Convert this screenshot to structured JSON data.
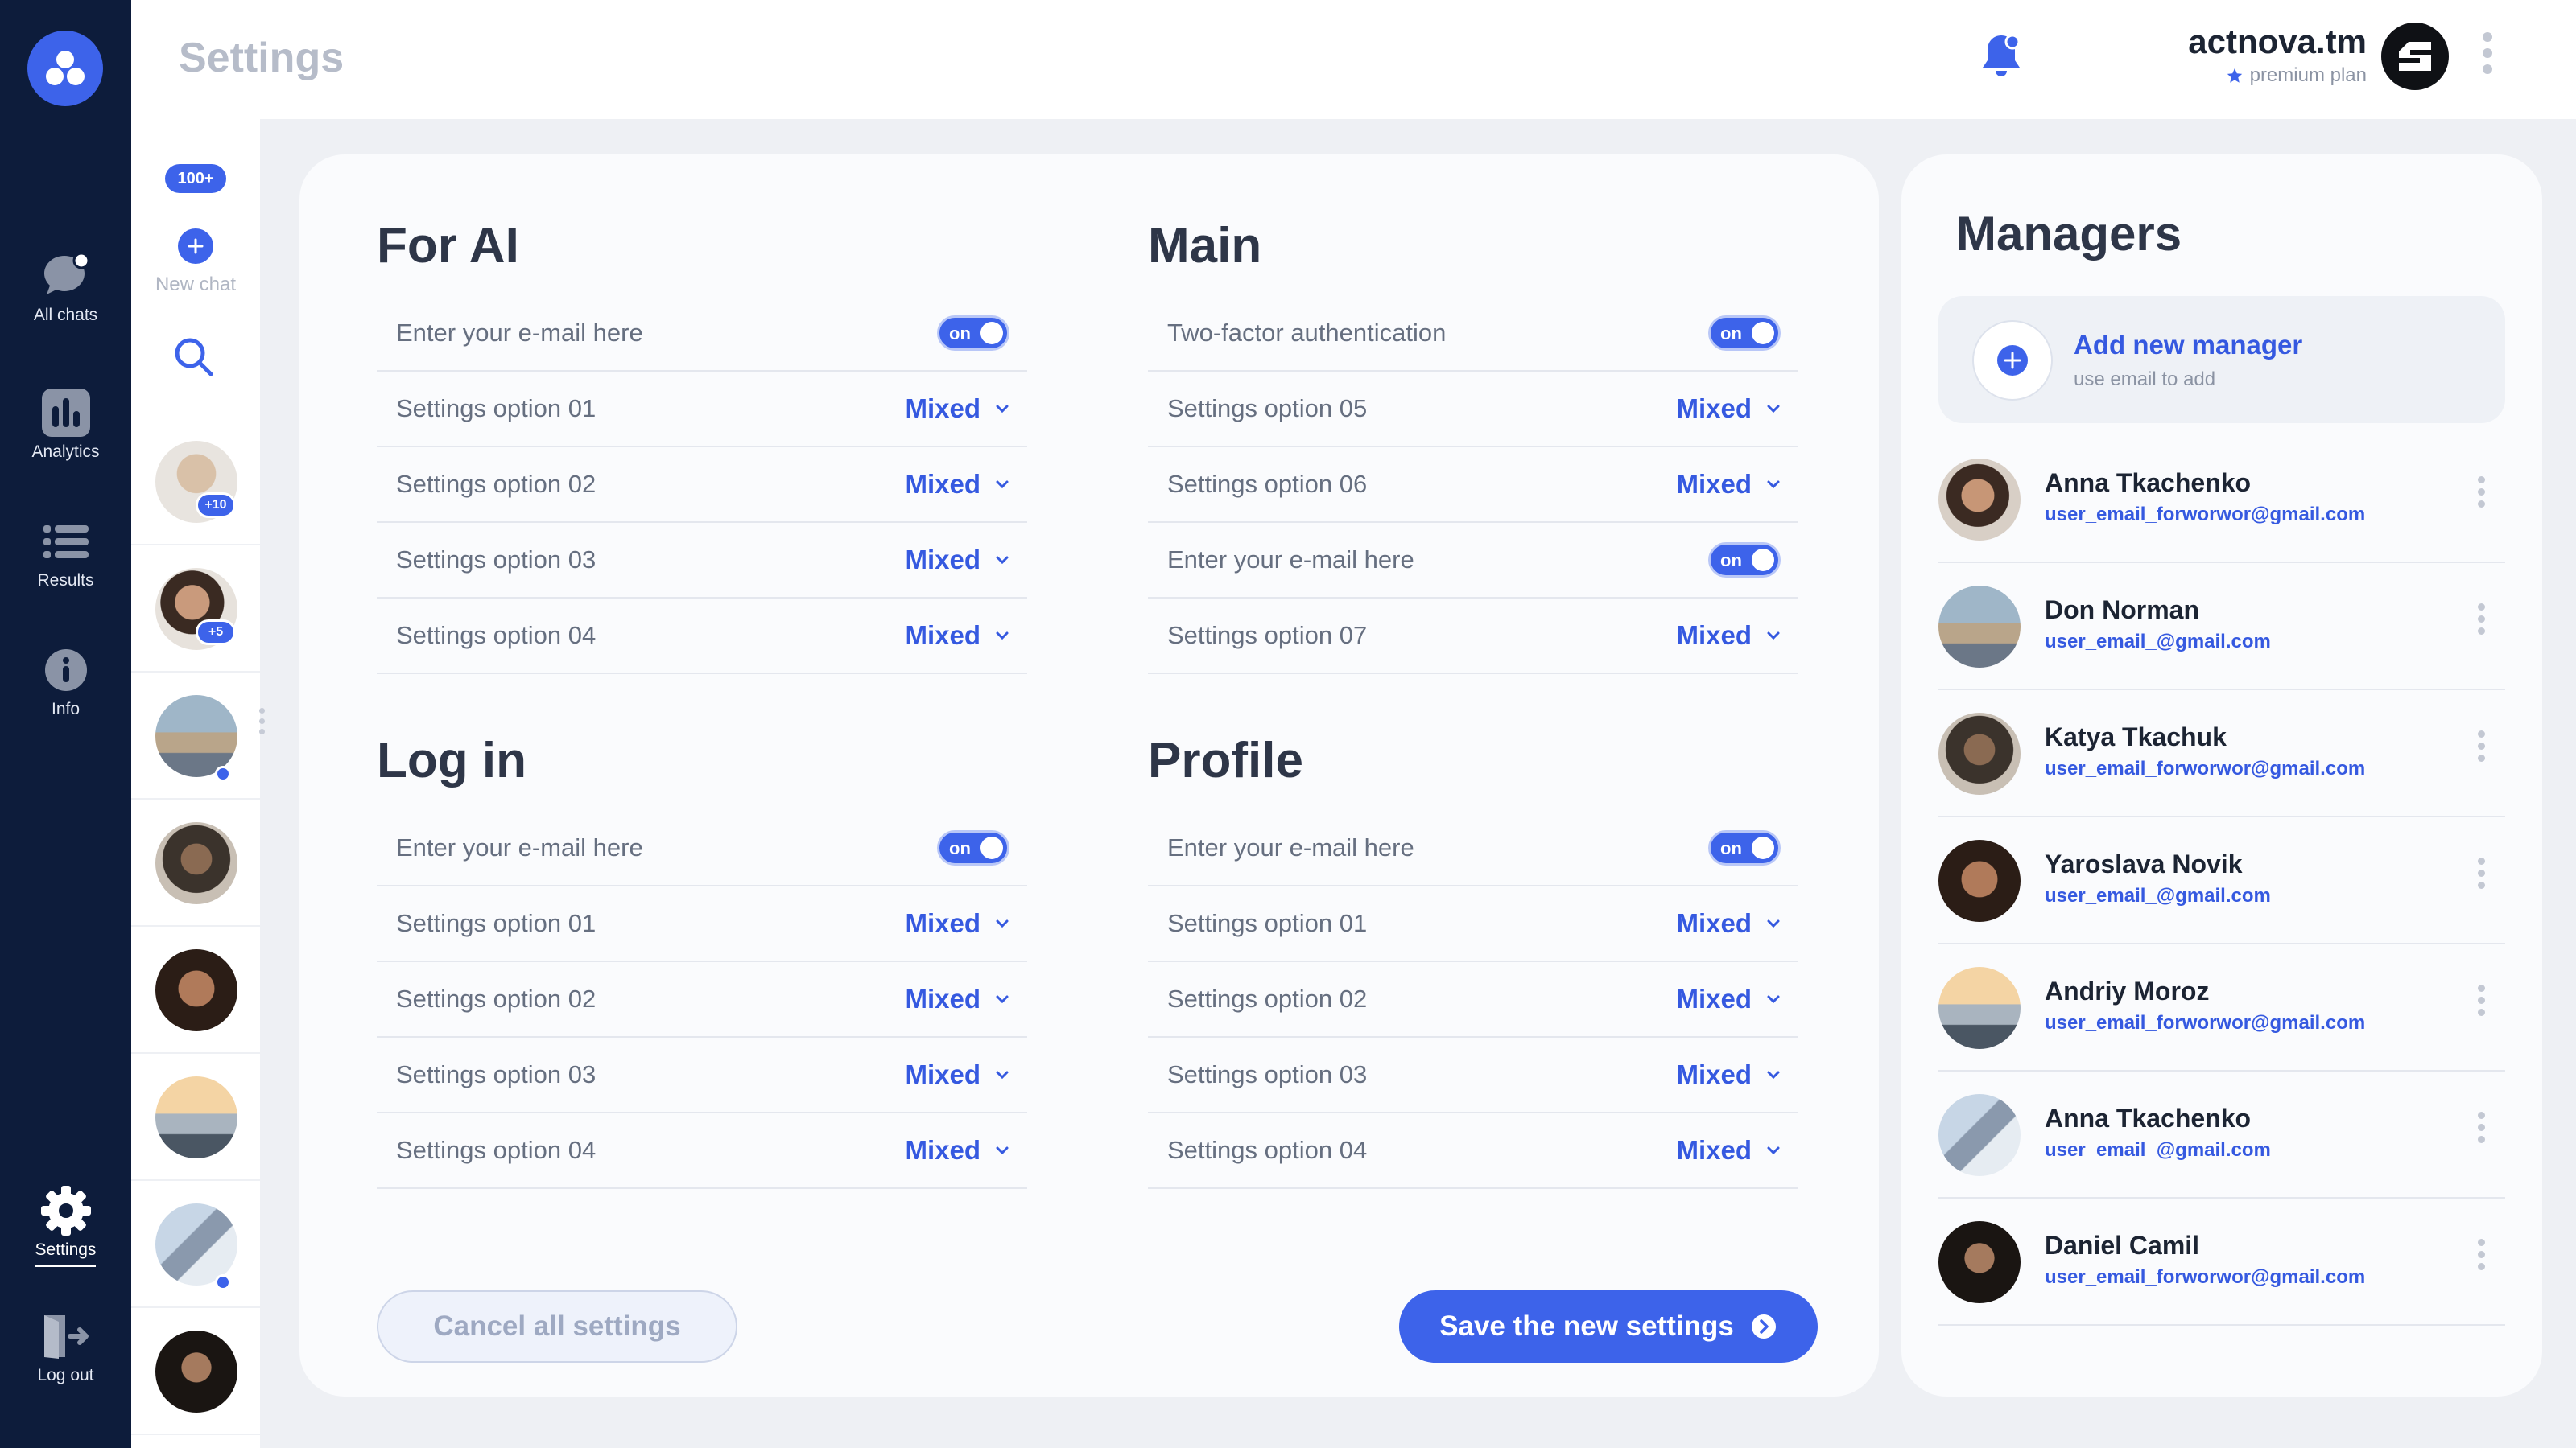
{
  "page_title": "Settings",
  "user": {
    "name": "actnova.tm",
    "plan": "premium plan"
  },
  "colors": {
    "accent": "#3d63ea",
    "rail": "#0d1c3b",
    "background": "#eef0f4"
  },
  "nav": [
    {
      "label": "All chats",
      "icon": "chat-bubble-icon",
      "active": false
    },
    {
      "label": "Analytics",
      "icon": "bar-chart-icon",
      "active": false
    },
    {
      "label": "Results",
      "icon": "list-icon",
      "active": false
    },
    {
      "label": "Info",
      "icon": "info-icon",
      "active": false
    },
    {
      "label": "Settings",
      "icon": "gear-icon",
      "active": true
    },
    {
      "label": "Log out",
      "icon": "logout-icon",
      "active": false
    }
  ],
  "chats": {
    "count_badge": "100+",
    "new_chat_label": "New chat",
    "items": [
      {
        "badge": "+10",
        "online": false
      },
      {
        "badge": "+5",
        "online": false
      },
      {
        "badge": "",
        "online": true
      },
      {
        "badge": "",
        "online": false
      },
      {
        "badge": "",
        "online": false
      },
      {
        "badge": "",
        "online": false
      },
      {
        "badge": "",
        "online": true
      },
      {
        "badge": "",
        "online": false
      }
    ]
  },
  "sections": {
    "for_ai": {
      "title": "For AI",
      "rows": [
        {
          "label": "Enter your e-mail here",
          "type": "toggle",
          "value": "on"
        },
        {
          "label": "Settings option 01",
          "type": "select",
          "value": "Mixed"
        },
        {
          "label": "Settings option 02",
          "type": "select",
          "value": "Mixed"
        },
        {
          "label": "Settings option 03",
          "type": "select",
          "value": "Mixed"
        },
        {
          "label": "Settings option 04",
          "type": "select",
          "value": "Mixed"
        }
      ]
    },
    "main": {
      "title": "Main",
      "rows": [
        {
          "label": "Two-factor authentication",
          "type": "toggle",
          "value": "on"
        },
        {
          "label": "Settings option 05",
          "type": "select",
          "value": "Mixed"
        },
        {
          "label": "Settings option 06",
          "type": "select",
          "value": "Mixed"
        },
        {
          "label": "Enter your e-mail here",
          "type": "toggle",
          "value": "on"
        },
        {
          "label": "Settings option 07",
          "type": "select",
          "value": "Mixed"
        }
      ]
    },
    "log_in": {
      "title": "Log in",
      "rows": [
        {
          "label": "Enter your e-mail here",
          "type": "toggle",
          "value": "on"
        },
        {
          "label": "Settings option 01",
          "type": "select",
          "value": "Mixed"
        },
        {
          "label": "Settings option 02",
          "type": "select",
          "value": "Mixed"
        },
        {
          "label": "Settings option 03",
          "type": "select",
          "value": "Mixed"
        },
        {
          "label": "Settings option 04",
          "type": "select",
          "value": "Mixed"
        }
      ]
    },
    "profile": {
      "title": "Profile",
      "rows": [
        {
          "label": "Enter your e-mail here",
          "type": "toggle",
          "value": "on"
        },
        {
          "label": "Settings option 01",
          "type": "select",
          "value": "Mixed"
        },
        {
          "label": "Settings option 02",
          "type": "select",
          "value": "Mixed"
        },
        {
          "label": "Settings option 03",
          "type": "select",
          "value": "Mixed"
        },
        {
          "label": "Settings option 04",
          "type": "select",
          "value": "Mixed"
        }
      ]
    }
  },
  "actions": {
    "cancel": "Cancel all settings",
    "save": "Save the new settings"
  },
  "managers": {
    "title": "Managers",
    "add_title": "Add new manager",
    "add_subtitle": "use email to add",
    "items": [
      {
        "name": "Anna Tkachenko",
        "email": "user_email_forworwor@gmail.com"
      },
      {
        "name": "Don Norman",
        "email": "user_email_@gmail.com"
      },
      {
        "name": "Katya Tkachuk",
        "email": "user_email_forworwor@gmail.com"
      },
      {
        "name": "Yaroslava Novik",
        "email": "user_email_@gmail.com"
      },
      {
        "name": "Andriy Moroz",
        "email": "user_email_forworwor@gmail.com"
      },
      {
        "name": "Anna Tkachenko",
        "email": "user_email_@gmail.com"
      },
      {
        "name": "Daniel Camil",
        "email": "user_email_forworwor@gmail.com"
      }
    ]
  }
}
